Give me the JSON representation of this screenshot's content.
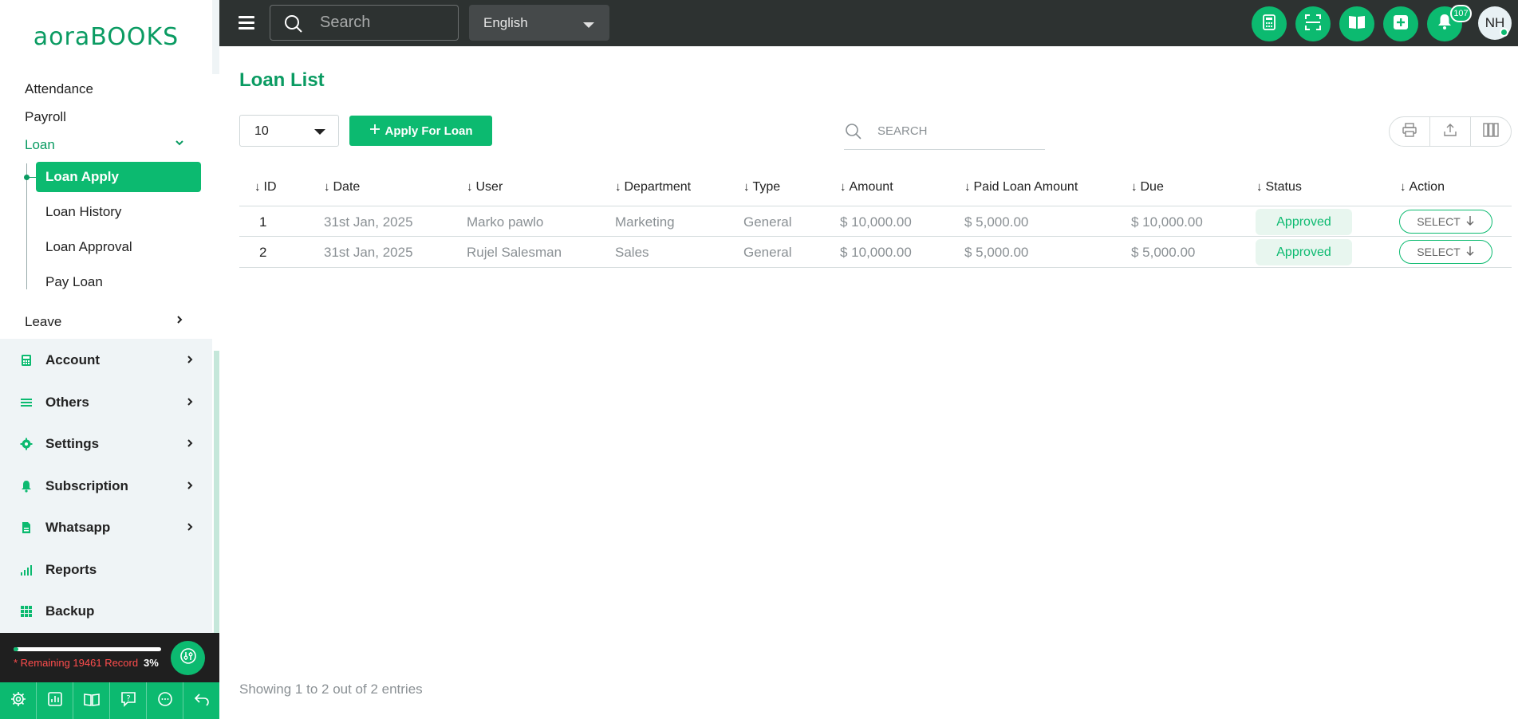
{
  "app": {
    "logo_text": "aoraBOOKS"
  },
  "sidebar": {
    "sub_items_top": [
      {
        "label": "Attendance"
      },
      {
        "label": "Payroll"
      },
      {
        "label": "Loan"
      }
    ],
    "loan_children": [
      {
        "label": "Loan Apply",
        "active": true
      },
      {
        "label": "Loan History"
      },
      {
        "label": "Loan Approval"
      },
      {
        "label": "Pay Loan"
      }
    ],
    "leave_label": "Leave",
    "main_items": [
      {
        "label": "Account",
        "icon": "calculator-icon"
      },
      {
        "label": "Others",
        "icon": "list-icon"
      },
      {
        "label": "Settings",
        "icon": "gear-icon"
      },
      {
        "label": "Subscription",
        "icon": "bell-icon"
      },
      {
        "label": "Whatsapp",
        "icon": "document-icon"
      },
      {
        "label": "Reports",
        "icon": "bar-chart-icon"
      },
      {
        "label": "Backup",
        "icon": "grid-icon"
      }
    ],
    "usage": {
      "remaining_text": "* Remaining 19461 Record",
      "percent_text": "3%",
      "percent": 3
    },
    "bottom_icons": [
      "gear-icon",
      "chart-icon",
      "book-icon",
      "help-icon",
      "chat-icon",
      "logout-icon"
    ]
  },
  "topbar": {
    "search_placeholder": "Search",
    "language": "English",
    "notification_count": "107",
    "avatar_initials": "NH",
    "action_icons": [
      "calculator-icon",
      "scan-icon",
      "book-icon",
      "plus-icon",
      "bell-icon"
    ]
  },
  "main": {
    "title": "Loan List",
    "page_size": "10",
    "apply_button": "Apply For Loan",
    "search_placeholder": "SEARCH",
    "columns": [
      "ID",
      "Date",
      "User",
      "Department",
      "Type",
      "Amount",
      "Paid Loan Amount",
      "Due",
      "Status",
      "Action"
    ],
    "rows": [
      {
        "id": "1",
        "date": "31st Jan, 2025",
        "user": "Marko pawlo",
        "department": "Marketing",
        "type": "General",
        "amount": "$ 10,000.00",
        "paid": "$ 5,000.00",
        "due": "$ 10,000.00",
        "status": "Approved",
        "action": "SELECT"
      },
      {
        "id": "2",
        "date": "31st Jan, 2025",
        "user": "Rujel Salesman",
        "department": "Sales",
        "type": "General",
        "amount": "$ 10,000.00",
        "paid": "$ 5,000.00",
        "due": "$ 5,000.00",
        "status": "Approved",
        "action": "SELECT"
      }
    ],
    "footer": "Showing 1 to 2 out of 2 entries"
  },
  "colors": {
    "accent": "#0cba70",
    "accent_dark": "#0a9b62",
    "topbar": "#2d3231"
  }
}
